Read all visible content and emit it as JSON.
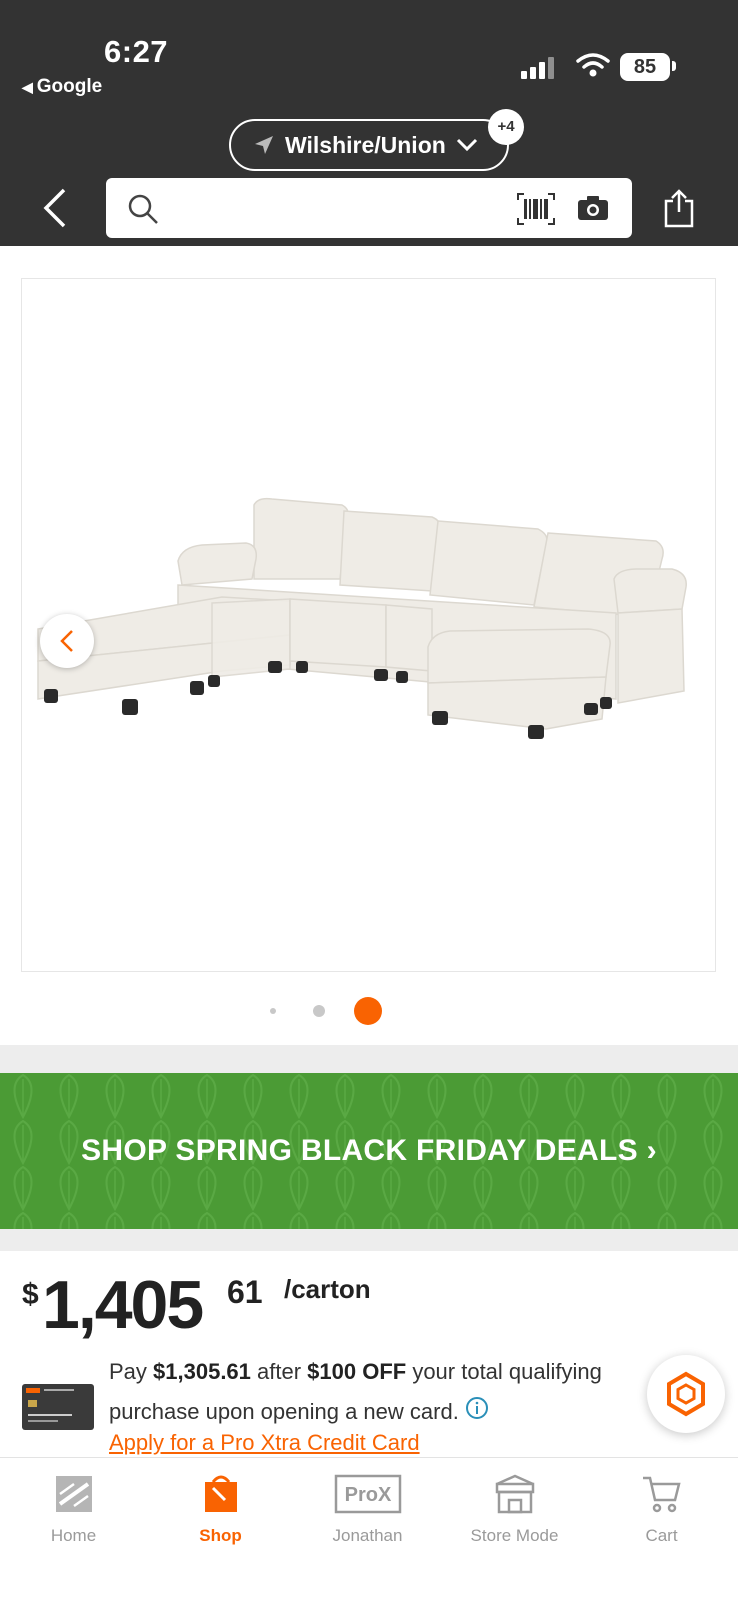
{
  "status_bar": {
    "time": "6:27",
    "back_app": "Google",
    "battery": "85"
  },
  "header": {
    "location": "Wilshire/Union",
    "location_badge": "+4",
    "search_placeholder": ""
  },
  "product": {
    "image_count": 3,
    "active_image_index": 2
  },
  "promo": {
    "label": "SHOP SPRING BLACK FRIDAY DEALS",
    "chevron": "›"
  },
  "price": {
    "currency": "$",
    "whole": "1,405",
    "cents": "61",
    "unit": "/carton"
  },
  "offer": {
    "line1_prefix": "Pay ",
    "amount": "$1,305.61",
    "line1_mid": " after ",
    "discount": "$100 OFF",
    "line1_suffix": " your total qualifying",
    "line2": "purchase upon opening a new card.",
    "link": "Apply for a Pro Xtra Credit Card"
  },
  "tabbar": {
    "items": [
      {
        "label": "Home",
        "icon": "home-depot-logo-icon"
      },
      {
        "label": "Shop",
        "icon": "shop-bag-icon"
      },
      {
        "label": "Jonathan",
        "icon": "pro-xtra-icon"
      },
      {
        "label": "Store Mode",
        "icon": "store-icon"
      },
      {
        "label": "Cart",
        "icon": "cart-icon"
      }
    ],
    "active": "Shop"
  },
  "colors": {
    "header_bg": "#333333",
    "accent": "#f96302",
    "promo_green": "#4b9b35"
  }
}
